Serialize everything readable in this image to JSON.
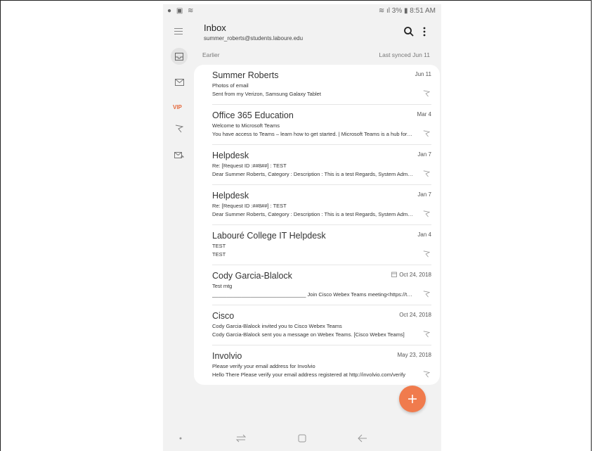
{
  "statusbar": {
    "icons_left": "● ▣ ≋",
    "right_text": "≋ ıl 3% ▮ 8:51 AM"
  },
  "header": {
    "title": "Inbox",
    "account": "summer_roberts@students.laboure.edu"
  },
  "sidebar": {
    "vip_label": "VIP"
  },
  "section": {
    "label": "Earlier",
    "synced": "Last synced Jun 11"
  },
  "emails": [
    {
      "sender": "Summer Roberts",
      "date": "Jun 11",
      "subject": "Photos of email",
      "preview": "Sent from my Verizon, Samsung Galaxy Tablet",
      "has_calendar": false
    },
    {
      "sender": "Office 365 Education",
      "date": "Mar 4",
      "subject": "Welcome to Microsoft Teams",
      "preview": "You have access to Teams – learn how to get started. | Microsoft Teams is a hub for teamwork",
      "has_calendar": false
    },
    {
      "sender": "Helpdesk",
      "date": "Jan 7",
      "subject": "Re: [Request ID :##8##] : TEST",
      "preview": "Dear Summer Roberts, Category : Description : This is a test Regards, System Administrator",
      "has_calendar": false
    },
    {
      "sender": "Helpdesk",
      "date": "Jan 7",
      "subject": "Re: [Request ID :##8##] : TEST",
      "preview": "Dear Summer Roberts, Category : Description : This is a test Regards, System Administrator",
      "has_calendar": false
    },
    {
      "sender": "Labouré College IT Helpdesk",
      "date": "Jan 4",
      "subject": "TEST",
      "preview": "TEST",
      "has_calendar": false
    },
    {
      "sender": "Cody Garcia-Blalock",
      "date": "Oct 24, 2018",
      "subject": "Test mtg",
      "preview": "________________________________ Join Cisco Webex Teams meeting<https://teams.webex.com",
      "has_calendar": true
    },
    {
      "sender": "Cisco",
      "date": "Oct 24, 2018",
      "subject": "Cody Garcia-Blalock invited you to Cisco Webex Teams",
      "preview": "Cody Garcia-Blalock sent you a message on Webex Teams.        [Cisco Webex Teams]",
      "has_calendar": false
    },
    {
      "sender": "Involvio",
      "date": "May 23, 2018",
      "subject": "Please verify your email address for Involvio",
      "preview": "Hello There Please verify your email address registered at http://involvio.com/verify",
      "has_calendar": false
    }
  ],
  "colors": {
    "accent": "#f07b4d",
    "vip": "#e5683b",
    "background": "#f2f2f2"
  },
  "icons": [
    "menu-icon",
    "search-icon",
    "more-icon",
    "inbox-icon",
    "mail-icon",
    "flag-icon",
    "move-mail-icon",
    "compose-icon",
    "calendar-icon",
    "recents-icon",
    "home-icon",
    "back-icon"
  ]
}
